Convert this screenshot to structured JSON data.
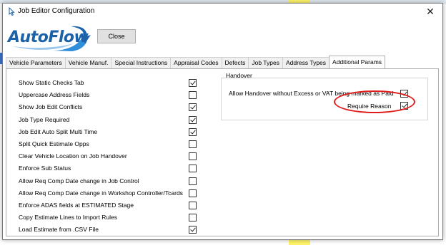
{
  "window": {
    "title": "Job Editor Configuration",
    "close_glyph": "✕",
    "app_icon": "cursor-arrow-icon"
  },
  "logo": {
    "text": "AutoFlow"
  },
  "toolbar": {
    "close_label": "Close"
  },
  "tabs": [
    {
      "label": "Vehicle Parameters",
      "active": false
    },
    {
      "label": "Vehicle Manuf.",
      "active": false
    },
    {
      "label": "Special Instructions",
      "active": false
    },
    {
      "label": "Appraisal Codes",
      "active": false
    },
    {
      "label": "Defects",
      "active": false
    },
    {
      "label": "Job Types",
      "active": false
    },
    {
      "label": "Address Types",
      "active": false
    },
    {
      "label": "Additional Params",
      "active": true
    }
  ],
  "options": [
    {
      "label": "Show Static Checks Tab",
      "checked": true
    },
    {
      "label": "Uppercase Address Fields",
      "checked": false
    },
    {
      "label": "Show Job Edit Conflicts",
      "checked": true
    },
    {
      "label": "Job Type Required",
      "checked": true
    },
    {
      "label": "Job Edit Auto Split Multi Time",
      "checked": true
    },
    {
      "label": "Split Quick Estimate Opps",
      "checked": false
    },
    {
      "label": "Clear Vehicle Location on Job Handover",
      "checked": false
    },
    {
      "label": "Enforce Sub Status",
      "checked": false
    },
    {
      "label": "Allow Req Comp Date change in Job Control",
      "checked": false
    },
    {
      "label": "Allow Req Comp Date change in Workshop Controller/Tcards",
      "checked": false
    },
    {
      "label": "Enforce ADAS fields at ESTIMATED Stage",
      "checked": false
    },
    {
      "label": "Copy Estimate Lines to Import Rules",
      "checked": false
    },
    {
      "label": "Load Estimate from .CSV File",
      "checked": true
    }
  ],
  "handover": {
    "title": "Handover",
    "allow_label": "Allow Handover without Excess or VAT being marked as Paid",
    "allow_checked": true,
    "reason_label": "Require Reason",
    "reason_checked": true
  },
  "colors": {
    "accent": "#1c62a8",
    "highlight_ring": "#e01b1b"
  }
}
